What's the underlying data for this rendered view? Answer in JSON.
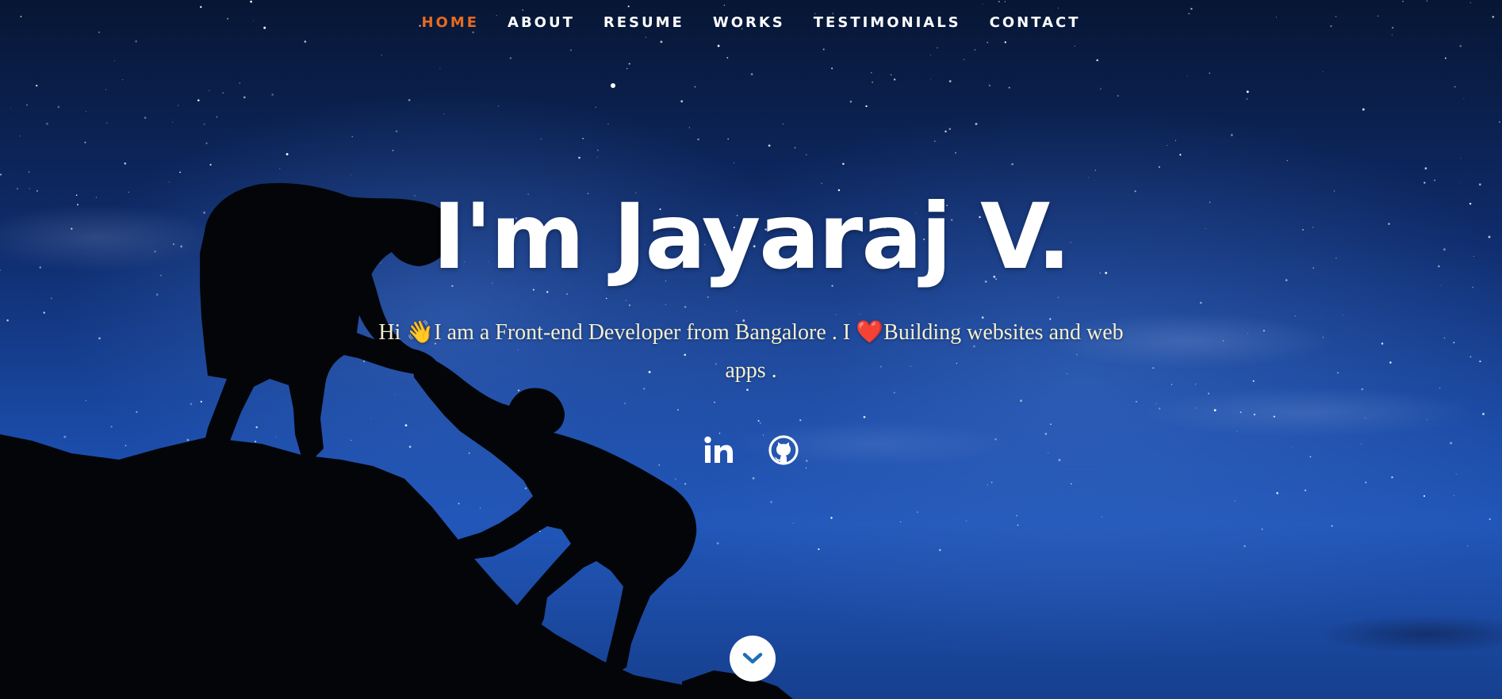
{
  "nav": {
    "items": [
      {
        "label": "HOME",
        "active": true
      },
      {
        "label": "ABOUT",
        "active": false
      },
      {
        "label": "RESUME",
        "active": false
      },
      {
        "label": "WORKS",
        "active": false
      },
      {
        "label": "TESTIMONIALS",
        "active": false
      },
      {
        "label": "CONTACT",
        "active": false
      }
    ],
    "active_color": "#e86a20"
  },
  "hero": {
    "headline": "I'm Jayaraj V.",
    "tagline_part1": "Hi",
    "wave_emoji": "👋",
    "tagline_part2": "I am a Front-end Developer from Bangalore . I",
    "heart_emoji": "❤️",
    "tagline_part3": "Building websites and web apps ."
  },
  "social": {
    "items": [
      {
        "icon": "linkedin-icon"
      },
      {
        "icon": "github-icon"
      }
    ]
  },
  "scroll_button": {
    "icon": "chevron-down-icon"
  },
  "colors": {
    "accent": "#e86a20",
    "sky_top": "#071634",
    "sky_mid": "#1a4aa6",
    "tagline": "#f4efd0"
  }
}
